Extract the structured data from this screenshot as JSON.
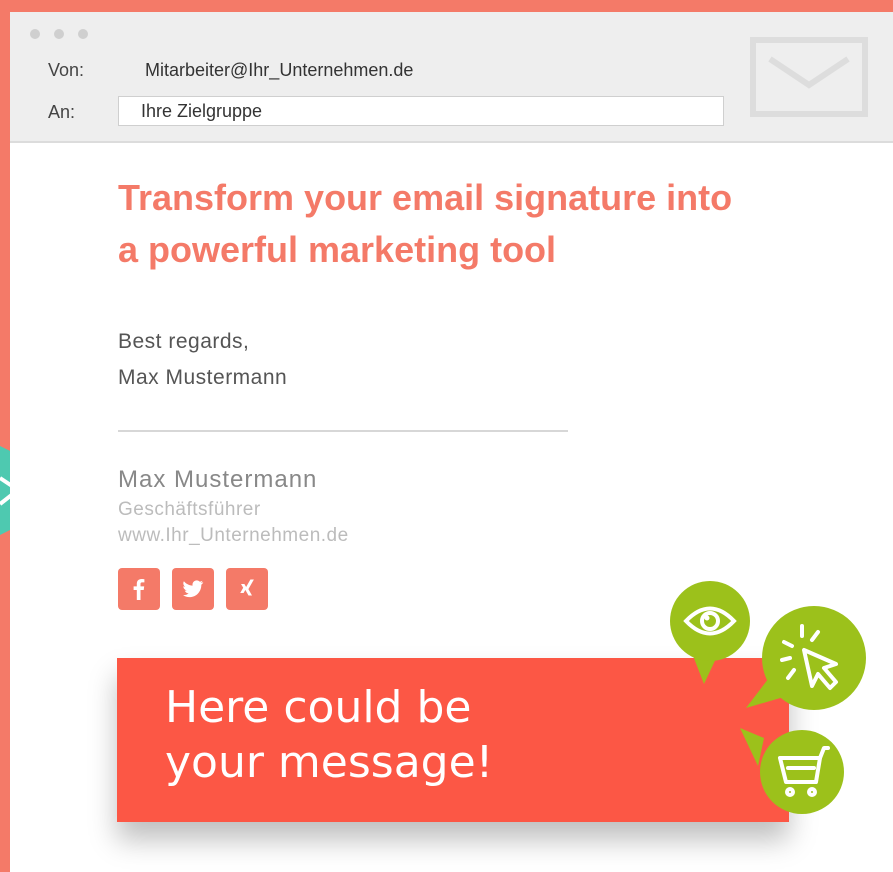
{
  "window": {
    "from_label": "Von:",
    "from_value": "Mitarbeiter@Ihr_Unternehmen.de",
    "to_label": "An:",
    "to_value": "Ihre Zielgruppe"
  },
  "email": {
    "headline_line1": "Transform your email signature into",
    "headline_line2": "a powerful marketing tool",
    "closing": "Best regards,",
    "sender": "Max Mustermann"
  },
  "signature": {
    "name": "Max Mustermann",
    "title": "Geschäftsführer",
    "website": "www.Ihr_Unternehmen.de",
    "social": [
      "facebook-icon",
      "twitter-icon",
      "xing-icon"
    ]
  },
  "banner": {
    "line1": "Here could be",
    "line2": "your message!"
  },
  "bubbles": [
    "eye-icon",
    "click-icon",
    "cart-icon"
  ],
  "colors": {
    "background": "#f47a68",
    "accent": "#f47a68",
    "banner": "#fc5745",
    "bubble": "#9cc11b",
    "arrow": "#4ec9b0"
  }
}
